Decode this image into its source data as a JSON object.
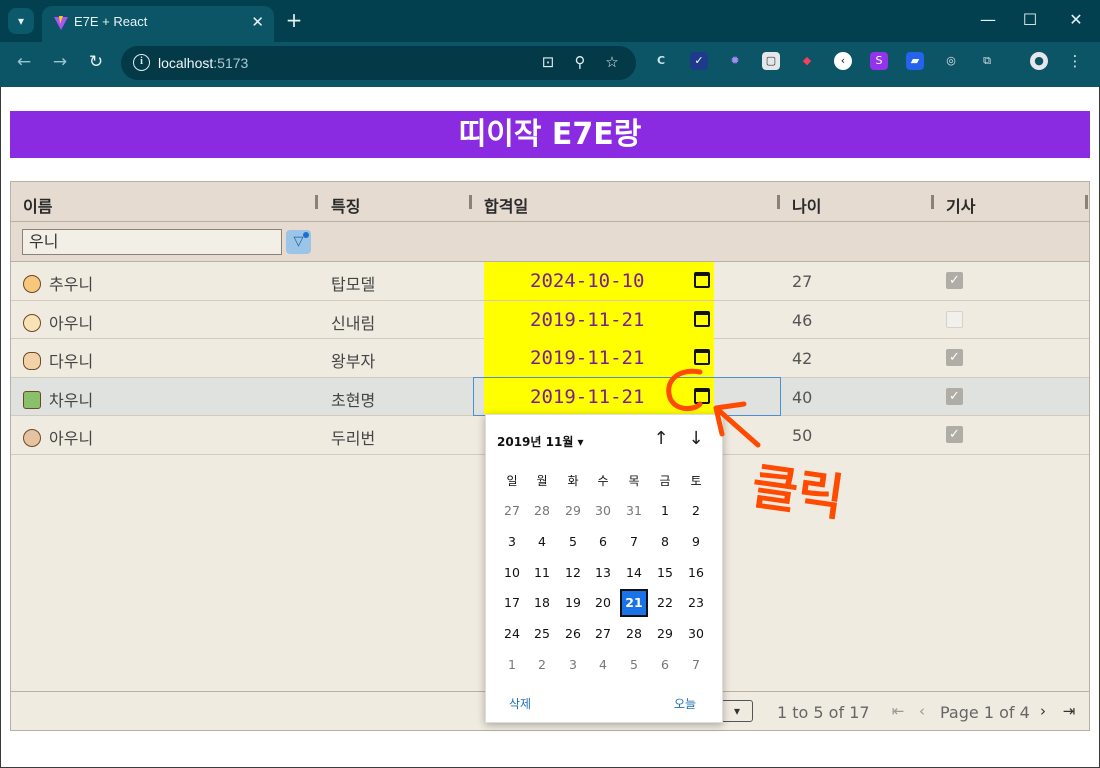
{
  "browser": {
    "tab_title": "E7E + React",
    "url_host": "localhost",
    "url_port": ":5173",
    "window_controls": {
      "minimize": "—",
      "maximize": "☐",
      "close": "✕"
    }
  },
  "app": {
    "title": "띠이작 E7E랑"
  },
  "grid": {
    "columns": [
      "이름",
      "특징",
      "합격일",
      "나이",
      "기사"
    ],
    "filter_value": "우니",
    "rows": [
      {
        "name": "추우니",
        "feature": "탑모델",
        "date": "2024-10-10",
        "age": "27",
        "engineer": true
      },
      {
        "name": "아우니",
        "feature": "신내림",
        "date": "2019-11-21",
        "age": "46",
        "engineer": false
      },
      {
        "name": "다우니",
        "feature": "왕부자",
        "date": "2019-11-21",
        "age": "42",
        "engineer": true
      },
      {
        "name": "차우니",
        "feature": "초현명",
        "date": "2019-11-21",
        "age": "40",
        "engineer": true
      },
      {
        "name": "아우니",
        "feature": "두리번",
        "date": "",
        "age": "50",
        "engineer": true
      }
    ],
    "footer": {
      "summary": "1 to 5 of 17",
      "page_label": "Page 1 of 4"
    }
  },
  "datepicker": {
    "month_label": "2019년 11월",
    "weekdays": [
      "일",
      "월",
      "화",
      "수",
      "목",
      "금",
      "토"
    ],
    "weeks": [
      [
        "27",
        "28",
        "29",
        "30",
        "31",
        "1",
        "2"
      ],
      [
        "3",
        "4",
        "5",
        "6",
        "7",
        "8",
        "9"
      ],
      [
        "10",
        "11",
        "12",
        "13",
        "14",
        "15",
        "16"
      ],
      [
        "17",
        "18",
        "19",
        "20",
        "21",
        "22",
        "23"
      ],
      [
        "24",
        "25",
        "26",
        "27",
        "28",
        "29",
        "30"
      ],
      [
        "1",
        "2",
        "3",
        "4",
        "5",
        "6",
        "7"
      ]
    ],
    "selected_day": "21",
    "clear_label": "삭제",
    "today_label": "오늘"
  },
  "annotation": {
    "text": "클릭",
    "color": "#ff4a00"
  },
  "colors": {
    "banner": "#8a2be2",
    "date_cell": "#ffff00",
    "date_text": "#7a1e95",
    "chrome": "#0b5566"
  }
}
